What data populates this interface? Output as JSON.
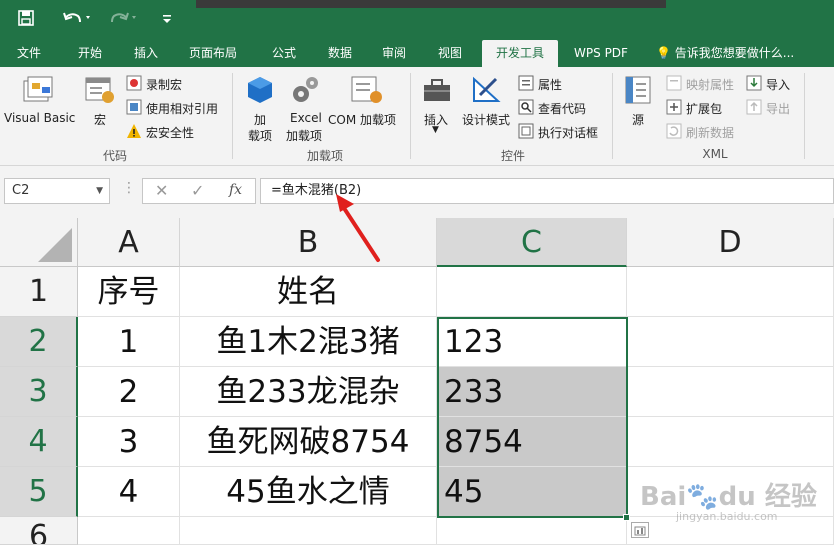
{
  "qat": {
    "save_icon": "save-icon",
    "undo_icon": "undo-icon",
    "redo_icon": "redo-icon",
    "customize_icon": "customize-icon"
  },
  "tabs": [
    {
      "label": "文件"
    },
    {
      "label": "开始"
    },
    {
      "label": "插入"
    },
    {
      "label": "页面布局"
    },
    {
      "label": "公式"
    },
    {
      "label": "数据"
    },
    {
      "label": "审阅"
    },
    {
      "label": "视图"
    },
    {
      "label": "开发工具",
      "active": true
    },
    {
      "label": "WPS PDF"
    },
    {
      "label": "告诉我您想要做什么..."
    }
  ],
  "ribbon": {
    "code": {
      "visual_basic": "Visual Basic",
      "macros": "宏",
      "record_macro": "录制宏",
      "relative_ref": "使用相对引用",
      "macro_security": "宏安全性",
      "group": "代码"
    },
    "addins": {
      "addins_1": "加",
      "addins_2": "载项",
      "excel_1": "Excel",
      "excel_2": "加载项",
      "com": "COM 加载项",
      "group": "加载项"
    },
    "controls": {
      "insert": "插入",
      "design_mode": "设计模式",
      "properties": "属性",
      "view_code": "查看代码",
      "run_dialog": "执行对话框",
      "group": "控件"
    },
    "xml": {
      "source": "源",
      "map_props": "映射属性",
      "expansion_packs": "扩展包",
      "refresh_data": "刷新数据",
      "import": "导入",
      "export": "导出",
      "group": "XML"
    }
  },
  "formula_bar": {
    "name_box": "C2",
    "fx": "fx",
    "formula": "=鱼木混猪(B2)"
  },
  "columns": [
    "A",
    "B",
    "C",
    "D"
  ],
  "rows": [
    "1",
    "2",
    "3",
    "4",
    "5",
    "6"
  ],
  "cells": {
    "A1": "序号",
    "B1": "姓名",
    "A2": "1",
    "B2": "鱼1木2混3猪",
    "C2": "123",
    "A3": "2",
    "B3": "鱼233龙混杂",
    "C3": "233",
    "A4": "3",
    "B4": "鱼死网破8754",
    "C4": "8754",
    "A5": "4",
    "B5": "45鱼水之情",
    "C5": "45"
  },
  "watermark": "Baidu经验 jingyan.baidu.com",
  "colors": {
    "accent": "#217346",
    "annotation_arrow": "#e0201d"
  }
}
